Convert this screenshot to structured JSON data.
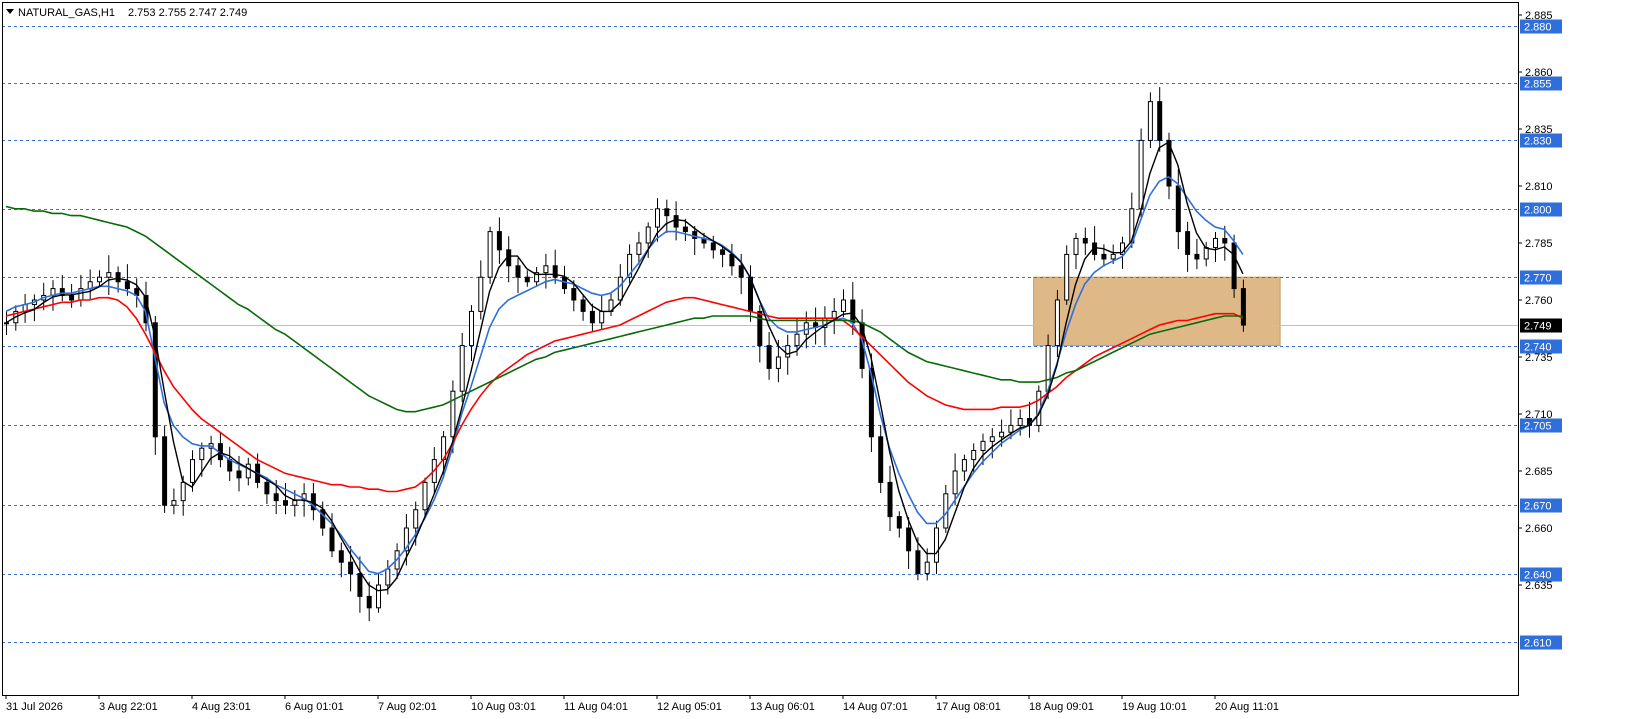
{
  "header": {
    "symbol": "NATURAL_GAS,H1",
    "ohlc": "2.753 2.755 2.747 2.749",
    "menu_icon": "triangle-down-icon"
  },
  "current_price": "2.749",
  "colors": {
    "sma_fast": "#000000",
    "sma_mid": "#2f6fdb",
    "sma_slow": "#ff0000",
    "sma_long": "#0a6a0a",
    "zone": "#deb887",
    "level_line": "#3a6fd8",
    "level_label_bg": "#2f6fdb",
    "grid": "#c0c0c0"
  },
  "chart_data": {
    "type": "line",
    "title": "NATURAL_GAS,H1",
    "xlabel": "",
    "ylabel": "",
    "ylim": [
      2.6,
      2.89
    ],
    "grid": false,
    "y_ticks": [
      "2.885",
      "2.860",
      "2.835",
      "2.810",
      "2.785",
      "2.760",
      "2.735",
      "2.710",
      "2.685",
      "2.660",
      "2.635"
    ],
    "x_ticks": [
      "31 Jul 2026",
      "3 Aug 22:01",
      "4 Aug 23:01",
      "6 Aug 01:01",
      "7 Aug 02:01",
      "10 Aug 03:01",
      "11 Aug 04:01",
      "12 Aug 05:01",
      "13 Aug 06:01",
      "14 Aug 07:01",
      "17 Aug 08:01",
      "18 Aug 09:01",
      "19 Aug 10:01",
      "20 Aug 11:01"
    ],
    "x_tick_index": [
      0,
      10,
      20,
      30,
      40,
      50,
      60,
      70,
      80,
      90,
      100,
      110,
      120,
      130
    ],
    "horizontal_levels": [
      "2.880",
      "2.855",
      "2.830",
      "2.800",
      "2.770",
      "2.740",
      "2.705",
      "2.670",
      "2.640",
      "2.610"
    ],
    "zone": {
      "x_from_index": 110.5,
      "x_to_index": 137,
      "y_low": 2.74,
      "y_high": 2.77
    },
    "close": [
      2.75,
      2.755,
      2.758,
      2.76,
      2.762,
      2.765,
      2.762,
      2.76,
      2.765,
      2.768,
      2.77,
      2.772,
      2.768,
      2.765,
      2.762,
      2.75,
      2.7,
      2.67,
      2.672,
      2.68,
      2.69,
      2.695,
      2.697,
      2.69,
      2.685,
      2.682,
      2.688,
      2.68,
      2.675,
      2.672,
      2.67,
      2.672,
      2.675,
      2.668,
      2.66,
      2.65,
      2.645,
      2.64,
      2.63,
      2.625,
      2.635,
      2.642,
      2.65,
      2.66,
      2.668,
      2.68,
      2.69,
      2.7,
      2.72,
      2.74,
      2.755,
      2.77,
      2.79,
      2.782,
      2.775,
      2.77,
      2.768,
      2.772,
      2.775,
      2.77,
      2.765,
      2.76,
      2.755,
      2.75,
      2.755,
      2.76,
      2.77,
      2.78,
      2.785,
      2.792,
      2.8,
      2.797,
      2.792,
      2.79,
      2.787,
      2.785,
      2.782,
      2.78,
      2.775,
      2.77,
      2.755,
      2.74,
      2.73,
      2.735,
      2.74,
      2.745,
      2.75,
      2.748,
      2.752,
      2.755,
      2.76,
      2.75,
      2.73,
      2.7,
      2.68,
      2.665,
      2.66,
      2.65,
      2.64,
      2.645,
      2.66,
      2.675,
      2.685,
      2.69,
      2.694,
      2.698,
      2.7,
      2.702,
      2.705,
      2.708,
      2.705,
      2.72,
      2.74,
      2.76,
      2.78,
      2.787,
      2.785,
      2.78,
      2.778,
      2.78,
      2.785,
      2.8,
      2.83,
      2.847,
      2.83,
      2.81,
      2.79,
      2.78,
      2.778,
      2.783,
      2.787,
      2.785,
      2.765,
      2.749
    ],
    "series": [
      {
        "name": "",
        "values": [
          2.755,
          2.757,
          2.758,
          2.759,
          2.761,
          2.762,
          2.763,
          2.763,
          2.764,
          2.765,
          2.766,
          2.766,
          2.765,
          2.764,
          2.762,
          2.755,
          2.735,
          2.715,
          2.705,
          2.7,
          2.697,
          2.696,
          2.696,
          2.693,
          2.69,
          2.688,
          2.686,
          2.684,
          2.682,
          2.679,
          2.677,
          2.675,
          2.673,
          2.67,
          2.666,
          2.662,
          2.657,
          2.651,
          2.646,
          2.641,
          2.64,
          2.642,
          2.646,
          2.651,
          2.657,
          2.664,
          2.672,
          2.682,
          2.695,
          2.71,
          2.722,
          2.735,
          2.748,
          2.756,
          2.76,
          2.762,
          2.764,
          2.766,
          2.768,
          2.769,
          2.768,
          2.767,
          2.765,
          2.763,
          2.762,
          2.763,
          2.766,
          2.771,
          2.776,
          2.782,
          2.787,
          2.79,
          2.79,
          2.789,
          2.788,
          2.787,
          2.786,
          2.784,
          2.781,
          2.777,
          2.77,
          2.76,
          2.752,
          2.748,
          2.746,
          2.746,
          2.747,
          2.748,
          2.749,
          2.751,
          2.752,
          2.75,
          2.743,
          2.728,
          2.71,
          2.695,
          2.684,
          2.675,
          2.667,
          2.662,
          2.662,
          2.666,
          2.672,
          2.678,
          2.684,
          2.689,
          2.693,
          2.697,
          2.7,
          2.703,
          2.705,
          2.71,
          2.72,
          2.732,
          2.746,
          2.758,
          2.767,
          2.772,
          2.775,
          2.777,
          2.779,
          2.784,
          2.795,
          2.806,
          2.812,
          2.814,
          2.811,
          2.805,
          2.799,
          2.795,
          2.792,
          2.791,
          2.786,
          2.78
        ]
      },
      {
        "name": "",
        "values": [
          2.753,
          2.754,
          2.755,
          2.756,
          2.757,
          2.758,
          2.759,
          2.759,
          2.76,
          2.76,
          2.761,
          2.761,
          2.76,
          2.757,
          2.752,
          2.745,
          2.737,
          2.729,
          2.722,
          2.717,
          2.712,
          2.708,
          2.705,
          2.702,
          2.699,
          2.696,
          2.693,
          2.69,
          2.688,
          2.686,
          2.684,
          2.683,
          2.682,
          2.681,
          2.68,
          2.679,
          2.679,
          2.678,
          2.678,
          2.677,
          2.677,
          2.676,
          2.676,
          2.677,
          2.678,
          2.681,
          2.685,
          2.69,
          2.697,
          2.705,
          2.712,
          2.718,
          2.723,
          2.727,
          2.73,
          2.733,
          2.736,
          2.738,
          2.74,
          2.742,
          2.743,
          2.744,
          2.745,
          2.746,
          2.747,
          2.748,
          2.749,
          2.751,
          2.753,
          2.755,
          2.757,
          2.759,
          2.76,
          2.761,
          2.761,
          2.76,
          2.759,
          2.758,
          2.757,
          2.756,
          2.755,
          2.754,
          2.753,
          2.752,
          2.752,
          2.752,
          2.752,
          2.752,
          2.752,
          2.752,
          2.751,
          2.748,
          2.744,
          2.74,
          2.736,
          2.732,
          2.728,
          2.724,
          2.721,
          2.718,
          2.716,
          2.714,
          2.713,
          2.712,
          2.712,
          2.712,
          2.712,
          2.713,
          2.713,
          2.713,
          2.714,
          2.716,
          2.719,
          2.722,
          2.726,
          2.729,
          2.732,
          2.735,
          2.737,
          2.739,
          2.741,
          2.743,
          2.745,
          2.747,
          2.749,
          2.75,
          2.751,
          2.751,
          2.752,
          2.753,
          2.754,
          2.754,
          2.754,
          2.752
        ]
      },
      {
        "name": "",
        "values": [
          2.801,
          2.8,
          2.8,
          2.799,
          2.799,
          2.798,
          2.798,
          2.797,
          2.797,
          2.796,
          2.795,
          2.794,
          2.793,
          2.792,
          2.79,
          2.788,
          2.785,
          2.782,
          2.779,
          2.776,
          2.773,
          2.77,
          2.767,
          2.764,
          2.761,
          2.758,
          2.756,
          2.753,
          2.75,
          2.747,
          2.745,
          2.742,
          2.739,
          2.736,
          2.733,
          2.73,
          2.727,
          2.724,
          2.721,
          2.718,
          2.716,
          2.714,
          2.712,
          2.711,
          2.711,
          2.712,
          2.713,
          2.714,
          2.716,
          2.718,
          2.72,
          2.722,
          2.724,
          2.726,
          2.728,
          2.73,
          2.732,
          2.734,
          2.735,
          2.737,
          2.738,
          2.739,
          2.74,
          2.741,
          2.742,
          2.743,
          2.744,
          2.745,
          2.746,
          2.747,
          2.748,
          2.749,
          2.75,
          2.751,
          2.752,
          2.752,
          2.753,
          2.753,
          2.753,
          2.753,
          2.753,
          2.752,
          2.751,
          2.751,
          2.751,
          2.751,
          2.751,
          2.751,
          2.751,
          2.751,
          2.751,
          2.751,
          2.75,
          2.748,
          2.746,
          2.743,
          2.74,
          2.737,
          2.735,
          2.733,
          2.732,
          2.731,
          2.73,
          2.729,
          2.728,
          2.727,
          2.726,
          2.725,
          2.725,
          2.724,
          2.724,
          2.724,
          2.725,
          2.726,
          2.728,
          2.729,
          2.731,
          2.733,
          2.735,
          2.737,
          2.739,
          2.741,
          2.743,
          2.745,
          2.746,
          2.747,
          2.748,
          2.749,
          2.75,
          2.751,
          2.752,
          2.753,
          2.753,
          2.753
        ]
      }
    ]
  }
}
